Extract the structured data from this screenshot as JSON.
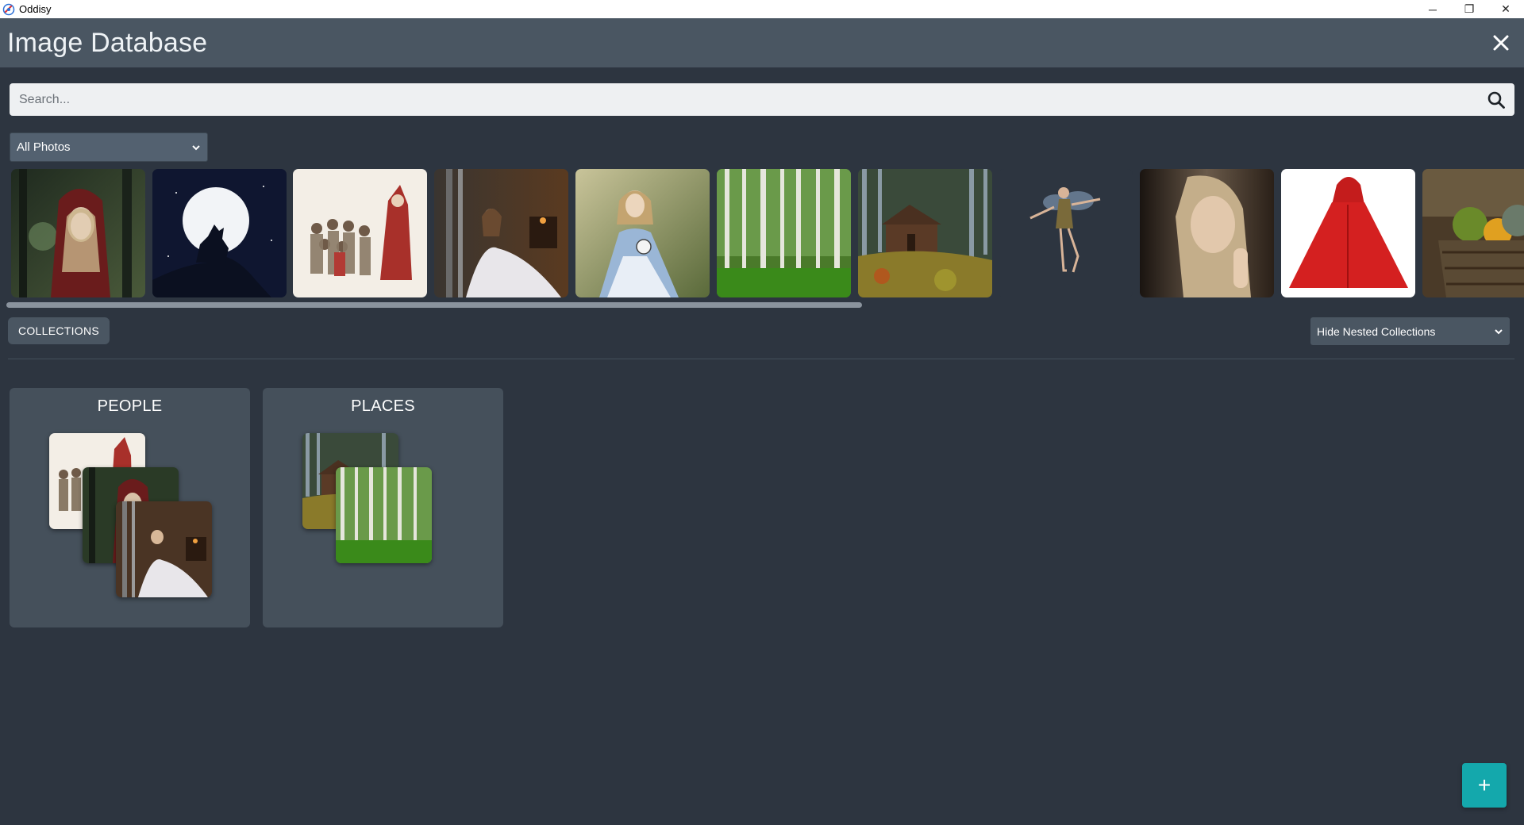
{
  "window": {
    "app_name": "Oddisy",
    "controls": {
      "minimize": "─",
      "restore": "❐",
      "close": "✕"
    }
  },
  "header": {
    "title": "Image Database",
    "close_icon": "close-icon"
  },
  "search": {
    "placeholder": "Search...",
    "value": ""
  },
  "filter": {
    "selected": "All Photos"
  },
  "thumbnails": [
    {
      "name": "thumb-red-hood-woman-forest"
    },
    {
      "name": "thumb-wolf-moon"
    },
    {
      "name": "thumb-illustrated-crowd"
    },
    {
      "name": "thumb-woman-white-dress"
    },
    {
      "name": "thumb-girl-blue-dress-clock"
    },
    {
      "name": "thumb-birch-forest"
    },
    {
      "name": "thumb-forest-cabin"
    },
    {
      "name": "thumb-fairy"
    },
    {
      "name": "thumb-blonde-woman-portrait"
    },
    {
      "name": "thumb-red-cloak"
    },
    {
      "name": "thumb-vegetable-basket"
    }
  ],
  "collections": {
    "button_label": "COLLECTIONS",
    "nested_option": "Hide Nested Collections",
    "cards": [
      {
        "title": "PEOPLE"
      },
      {
        "title": "PLACES"
      }
    ]
  },
  "fab": {
    "label": "+"
  },
  "colors": {
    "background": "#2d3540",
    "header": "#4a5662",
    "card": "#45505b",
    "accent": "#14a8ac"
  }
}
